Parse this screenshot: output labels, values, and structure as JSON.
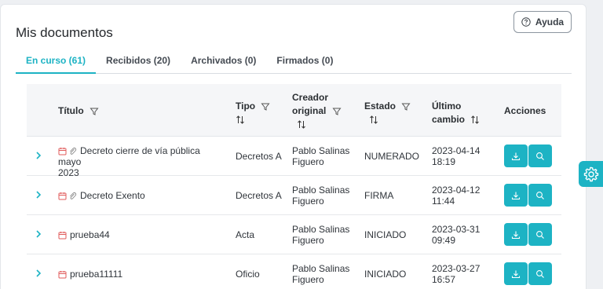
{
  "title": "Mis documentos",
  "help_label": "Ayuda",
  "tabs": [
    {
      "label": "En curso (61)",
      "active": true
    },
    {
      "label": "Recibidos (20)",
      "active": false
    },
    {
      "label": "Archivados (0)",
      "active": false
    },
    {
      "label": "Firmados (0)",
      "active": false
    }
  ],
  "columns": {
    "titulo": "Título",
    "tipo": "Tipo",
    "creador_line1": "Creador",
    "creador_line2": "original",
    "estado": "Estado",
    "cambio_line1": "Último",
    "cambio_line2": "cambio",
    "acciones": "Acciones"
  },
  "rows": [
    {
      "title_line1": "Decreto cierre de vía pública mayo",
      "title_line2": "2023",
      "has_calendar": true,
      "has_clip": true,
      "tipo": "Decretos A",
      "creador_line1": "Pablo Salinas",
      "creador_line2": "Figuero",
      "estado": "NUMERADO",
      "fecha": "2023-04-14",
      "hora": "18:19"
    },
    {
      "title_line1": "Decreto Exento",
      "title_line2": "",
      "has_calendar": true,
      "has_clip": true,
      "tipo": "Decretos A",
      "creador_line1": "Pablo Salinas",
      "creador_line2": "Figuero",
      "estado": "FIRMA",
      "fecha": "2023-04-12",
      "hora": "11:44"
    },
    {
      "title_line1": "prueba44",
      "title_line2": "",
      "has_calendar": true,
      "has_clip": false,
      "tipo": "Acta",
      "creador_line1": "Pablo Salinas",
      "creador_line2": "Figuero",
      "estado": "INICIADO",
      "fecha": "2023-03-31",
      "hora": "09:49"
    },
    {
      "title_line1": "prueba11111",
      "title_line2": "",
      "has_calendar": true,
      "has_clip": false,
      "tipo": "Oficio",
      "creador_line1": "Pablo Salinas",
      "creador_line2": "Figuero",
      "estado": "INICIADO",
      "fecha": "2023-03-27",
      "hora": "16:57"
    }
  ],
  "colors": {
    "accent": "#1db3c4",
    "calendar_icon": "#e05a5a"
  }
}
